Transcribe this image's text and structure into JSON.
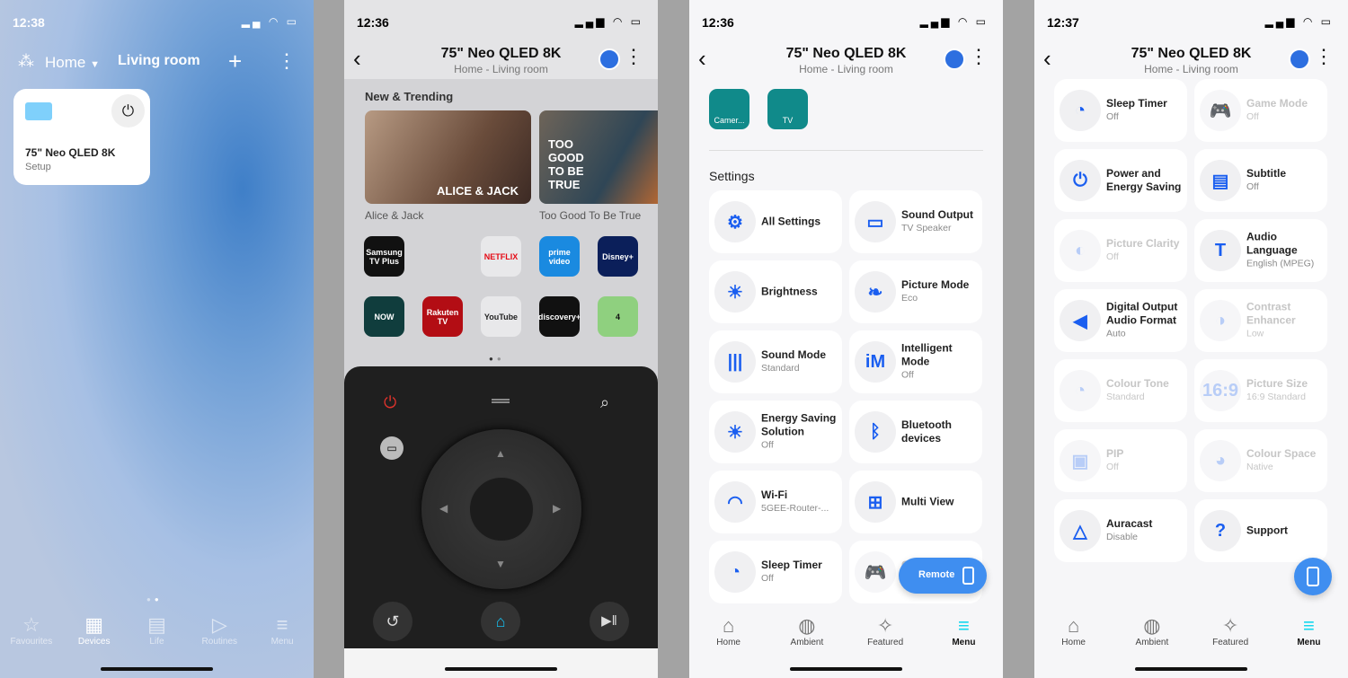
{
  "colors": {
    "accent": "#1a5ef0",
    "fab": "#3f8ef0",
    "menu_active": "#16d8ee",
    "power": "#e0332c"
  },
  "p1": {
    "time": "12:38",
    "home": "Home",
    "room": "Living room",
    "device_name": "75\" Neo QLED 8K",
    "device_status": "Setup",
    "nav": [
      {
        "label": "Favourites",
        "icon": "star-icon"
      },
      {
        "label": "Devices",
        "icon": "devices-icon"
      },
      {
        "label": "Life",
        "icon": "life-icon"
      },
      {
        "label": "Routines",
        "icon": "play-icon"
      },
      {
        "label": "Menu",
        "icon": "menu-icon"
      }
    ]
  },
  "device": {
    "title": "75\" Neo QLED 8K",
    "subtitle": "Home - Living room"
  },
  "p2": {
    "time": "12:36",
    "section": "New & Trending",
    "trending": [
      {
        "title": "Alice & Jack",
        "art": "ALICE & JACK"
      },
      {
        "title": "Too Good To Be True",
        "art": "TOO GOOD TO BE TRUE"
      }
    ],
    "apps": [
      "Samsung TV Plus",
      "",
      "NETFLIX",
      "prime video",
      "Disney+",
      "NOW",
      "Rakuten TV",
      "YouTube",
      "discovery+",
      "4"
    ]
  },
  "p3": {
    "time": "12:36",
    "shortcuts": [
      "Camer...",
      "TV"
    ],
    "settings_title": "Settings",
    "items": [
      {
        "title": "All Settings",
        "sub": "",
        "icon": "⚙"
      },
      {
        "title": "Sound Output",
        "sub": "TV Speaker",
        "icon": "▭"
      },
      {
        "title": "Brightness",
        "sub": "",
        "icon": "☀"
      },
      {
        "title": "Picture Mode",
        "sub": "Eco",
        "icon": "❧"
      },
      {
        "title": "Sound Mode",
        "sub": "Standard",
        "icon": "|||"
      },
      {
        "title": "Intelligent Mode",
        "sub": "Off",
        "icon": "iM"
      },
      {
        "title": "Energy Saving Solution",
        "sub": "Off",
        "icon": "☀"
      },
      {
        "title": "Bluetooth devices",
        "sub": "",
        "icon": "ᛒ"
      },
      {
        "title": "Wi-Fi",
        "sub": "5GEE-Router-...",
        "icon": "◠"
      },
      {
        "title": "Multi View",
        "sub": "",
        "icon": "⊞"
      },
      {
        "title": "Sleep Timer",
        "sub": "Off",
        "icon": "◔"
      },
      {
        "title": "Game Mode",
        "sub": "Off",
        "icon": "🎮",
        "disabled": true
      }
    ],
    "remote": "Remote",
    "nav": [
      {
        "label": "Home",
        "icon": "home-icon"
      },
      {
        "label": "Ambient",
        "icon": "ambient-icon"
      },
      {
        "label": "Featured",
        "icon": "featured-icon"
      },
      {
        "label": "Menu",
        "icon": "menu-icon"
      }
    ]
  },
  "p4": {
    "time": "12:37",
    "items": [
      {
        "title": "Sleep Timer",
        "sub": "Off",
        "icon": "◔"
      },
      {
        "title": "Game Mode",
        "sub": "Off",
        "icon": "🎮",
        "disabled": true
      },
      {
        "title": "Power and Energy Saving",
        "sub": "",
        "icon": "⏻"
      },
      {
        "title": "Subtitle",
        "sub": "Off",
        "icon": "▤"
      },
      {
        "title": "Picture Clarity",
        "sub": "Off",
        "icon": "◐",
        "disabled": true
      },
      {
        "title": "Audio Language",
        "sub": "English (MPEG)",
        "icon": "T"
      },
      {
        "title": "Digital Output Audio Format",
        "sub": "Auto",
        "icon": "◀"
      },
      {
        "title": "Contrast Enhancer",
        "sub": "Low",
        "icon": "◑",
        "disabled": true
      },
      {
        "title": "Colour Tone",
        "sub": "Standard",
        "icon": "◔",
        "disabled": true
      },
      {
        "title": "Picture Size",
        "sub": "16:9 Standard",
        "icon": "16:9",
        "disabled": true
      },
      {
        "title": "PIP",
        "sub": "Off",
        "icon": "▣",
        "disabled": true
      },
      {
        "title": "Colour Space",
        "sub": "Native",
        "icon": "◕",
        "disabled": true
      },
      {
        "title": "Auracast",
        "sub": "Disable",
        "icon": "△"
      },
      {
        "title": "Support",
        "sub": "",
        "icon": "?"
      }
    ]
  }
}
